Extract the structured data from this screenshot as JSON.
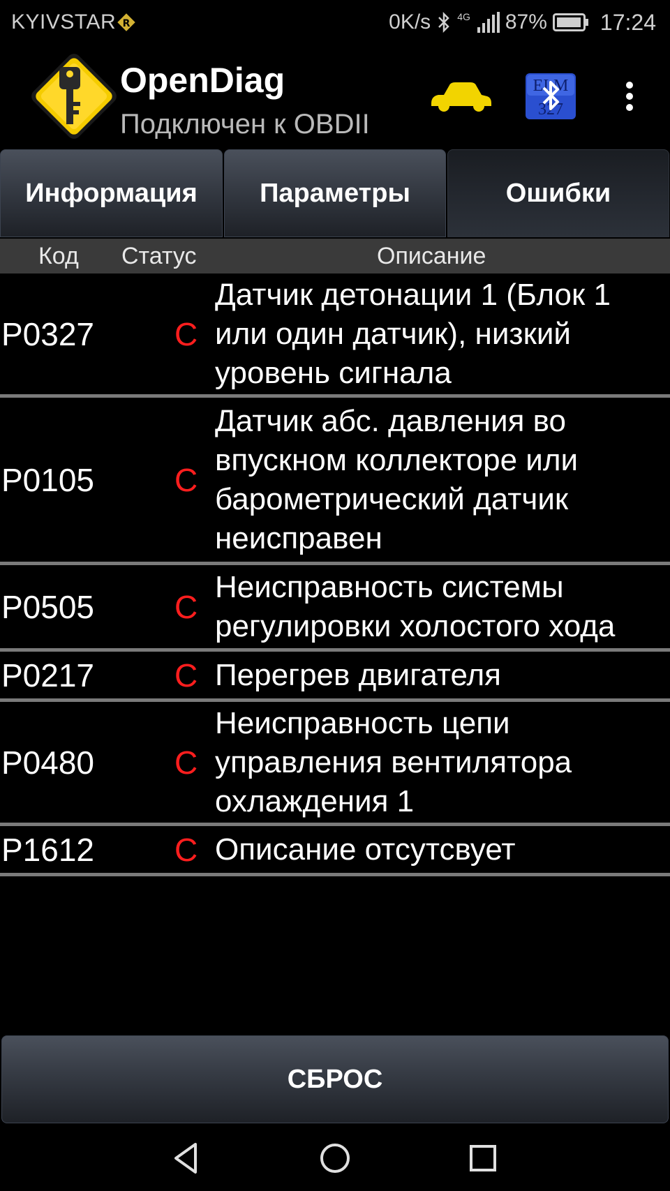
{
  "status_bar": {
    "carrier": "KYIVSTAR",
    "speed": "0K/s",
    "network": "4G",
    "battery": "87%",
    "time": "17:24"
  },
  "app_bar": {
    "title": "OpenDiag",
    "subtitle": "Подключен к OBDII",
    "icons": [
      "app-logo-key-icon",
      "car-icon",
      "bluetooth-elm327-icon",
      "overflow-menu-icon"
    ]
  },
  "tabs": [
    {
      "label": "Информация",
      "active": false
    },
    {
      "label": "Параметры",
      "active": false
    },
    {
      "label": "Ошибки",
      "active": true
    }
  ],
  "table": {
    "headers": {
      "code": "Код",
      "status": "Статус",
      "description": "Описание"
    },
    "rows": [
      {
        "code": "P0327",
        "status": "C",
        "description": "Датчик детонации 1 (Блок 1 или один датчик), низкий уровень сигнала"
      },
      {
        "code": "P0105",
        "status": "C",
        "description": "Датчик абс. давления во впускном коллекторе или барометрический датчик неисправен"
      },
      {
        "code": "P0505",
        "status": "C",
        "description": "Неисправность системы регулировки холостого хода"
      },
      {
        "code": "P0217",
        "status": "C",
        "description": "Перегрев двигателя"
      },
      {
        "code": "P0480",
        "status": "C",
        "description": "Неисправность цепи управления вентилятора охлаждения 1"
      },
      {
        "code": "P1612",
        "status": "C",
        "description": "Описание отсутсвует"
      }
    ]
  },
  "reset_button": {
    "label": "СБРОС"
  },
  "colors": {
    "status_error": "#ff1e1e",
    "car_icon": "#f2d400",
    "logo": "#f5cc00",
    "bluetooth_bg": "#2a4fd0"
  }
}
